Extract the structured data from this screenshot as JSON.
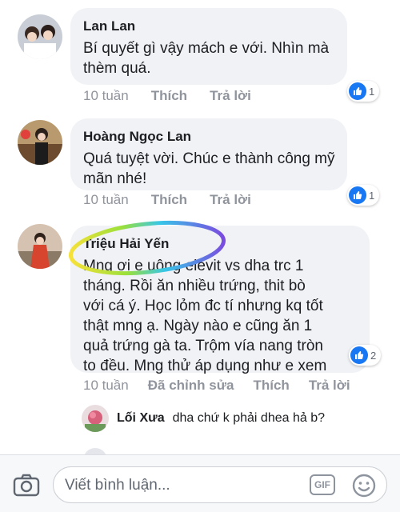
{
  "comments": [
    {
      "author": "Lan Lan",
      "lines": [
        "Bí quyết gì vậy mách e với. Nhìn mà",
        "thèm quá."
      ],
      "time": "10 tuần",
      "like_label": "Thích",
      "reply_label": "Trả lời",
      "reaction_count": "1"
    },
    {
      "author": "Hoàng Ngọc Lan",
      "lines": [
        "Quá tuyệt vời. Chúc e thành công mỹ",
        "mãn nhé!"
      ],
      "time": "10 tuần",
      "like_label": "Thích",
      "reply_label": "Trả lời",
      "reaction_count": "1"
    },
    {
      "author": "Triệu Hải Yến",
      "lines": [
        "Mng ơi e uông elevit vs dha trc 1",
        "tháng. Rồi ăn nhiều trứng, thit bò",
        "với cá ý. Học lỏm đc tí nhưng kq tốt",
        "thật mng ạ. Ngày nào e cũng ăn 1",
        "quả trứng gà ta. Trộm vía nang tròn",
        "to đều. Mng thử áp dụng như e xem"
      ],
      "time": "10 tuần",
      "edited_label": "Đã chỉnh sửa",
      "like_label": "Thích",
      "reply_label": "Trả lời",
      "reaction_count": "2"
    }
  ],
  "reply": {
    "author": "Lối Xưa",
    "text": "dha chứ k phải dhea hả b?"
  },
  "composer": {
    "placeholder": "Viết bình luận...",
    "gif_label": "GIF",
    "icons": [
      "camera-icon",
      "gif-icon",
      "smiley-icon"
    ]
  },
  "colors": {
    "like_blue": "#1877f2",
    "bubble_bg": "#f0f2f5",
    "meta_gray": "#90949c"
  }
}
